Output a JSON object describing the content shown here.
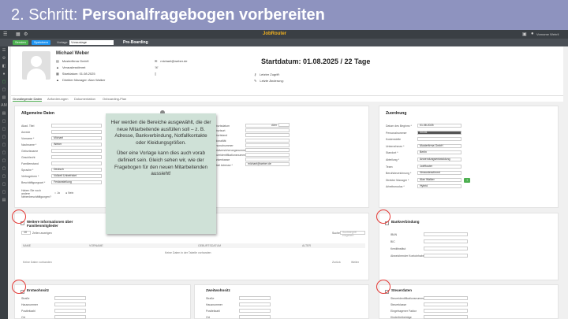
{
  "slide": {
    "title_prefix": "2. Schritt: ",
    "title_bold": "Personalfragebogen vorbereiten"
  },
  "app": {
    "brand": "JobRouter",
    "user": "Vorname Wehrli",
    "toolbar": {
      "send": "Senden",
      "save": "Speichern",
      "template_label": "Vorlage",
      "template_value": "Vorauslage",
      "process": "Pre-Boarding"
    },
    "sidebar_items": [
      "☰",
      "⚙",
      "◧",
      "●",
      "▢",
      "▢",
      "▤",
      "AM",
      "▤",
      "▢",
      "▢",
      "▢",
      "▢",
      "▢",
      "▢",
      "▢",
      "▢",
      "▢",
      "▢",
      "▤"
    ]
  },
  "profile": {
    "name": "Michael Weber",
    "company": "Musterfirma GmbH",
    "position": "Verauslesstimmt",
    "start": "Startdatum: 01.08.2025",
    "manager": "Direkter Manager: Alan Walker",
    "email": "michael@weber.de",
    "startdatum": "Startdatum: 01.08.2025 / 22 Tage",
    "access": "Letzter Zugriff:",
    "change": "Letzte Änderung:"
  },
  "tabs": [
    "Grundlegende Daten",
    "Anforderungen",
    "Dokumentation",
    "Onboarding-Plan"
  ],
  "allgemein": {
    "title": "Allgemeine Daten",
    "fields": [
      {
        "label": "Akad. Titel",
        "value": ""
      },
      {
        "label": "Anrede",
        "value": ""
      },
      {
        "label": "Vorname *",
        "value": "Michael"
      },
      {
        "label": "Nachname *",
        "value": "Weber"
      },
      {
        "label": "Geburtsname",
        "value": ""
      },
      {
        "label": "Geschlecht",
        "value": ""
      },
      {
        "label": "Familienstand",
        "value": ""
      },
      {
        "label": "Sprache *",
        "value": "Deutsch"
      },
      {
        "label": "Vertragsform *",
        "value": "Vollzeit Unbefristet"
      },
      {
        "label": "Beschäftigungsart *",
        "value": "Festanstellung"
      }
    ],
    "question": "Haben Sie noch andere Nebenbeschäftigungen?",
    "yes": "Ja",
    "no": "Nein",
    "right_labels": [
      "Geburtsdatum",
      "Geburtsort",
      "Geburtsland",
      "Nationalität",
      "Personalnummer",
      "Sozialversicherungsnummer",
      "Steueridentifikationsnummer",
      "Krankenkasse",
      "E-Mail Adresse *"
    ],
    "alter": "Alter",
    "email": "michael@weber.de"
  },
  "zuordnung": {
    "title": "Zuordnung",
    "fields": [
      {
        "label": "Datum des Beginns *",
        "value": "01.08.2025"
      },
      {
        "label": "Personalnummer",
        "value": "00181",
        "dark": true
      },
      {
        "label": "Kostenstelle",
        "value": ""
      },
      {
        "label": "Unternehmen *",
        "value": "Musterfirma GmbH"
      },
      {
        "label": "Standort *",
        "value": "Berlin"
      },
      {
        "label": "Abteilung *",
        "value": "Anwendungsentwicklung"
      },
      {
        "label": "Team",
        "value": "JobRouter"
      },
      {
        "label": "Berufsbezeichnung *",
        "value": "Verauslesstimmt"
      },
      {
        "label": "Direkter Manager *",
        "value": "Alan Walker"
      },
      {
        "label": "Arbeitsmodus *",
        "value": "Hybrid"
      }
    ]
  },
  "familie": {
    "title": "Weitere Informationen über Familienmitglieder",
    "entries_label": "Zeilen anzeigen",
    "entries_value": "10",
    "search_label": "Suche:",
    "search_placeholder": "Suchbegriff eingeben",
    "columns": [
      "NAME",
      "VORNAME",
      "GEBURTSDATUM",
      "ALTER"
    ],
    "empty": "Keine Daten in der Tabelle vorhanden",
    "info": "Keine Daten vorhanden",
    "prev": "Zurück",
    "next": "Weiter"
  },
  "bank": {
    "title": "Bankverbindung",
    "labels": [
      "IBAN",
      "BIC",
      "Kreditinstitut",
      "Abweichender Kontoinhaber"
    ]
  },
  "erstwohnsitz": {
    "title": "Erstwohnsitz",
    "labels": [
      "Straße",
      "Hausnummer",
      "Postleitzahl",
      "Ort"
    ]
  },
  "zweitwohnsitz": {
    "title": "Zweitwohnsitz",
    "labels": [
      "Straße",
      "Hausnummer",
      "Postleitzahl",
      "Ort"
    ]
  },
  "steuer": {
    "title": "Steuerdaten",
    "labels": [
      "Steueridentifikationsnummer",
      "Steuerklasse",
      "Eingetragener Faktor",
      "Kinderfreibeträge"
    ]
  },
  "callout": {
    "p1": "Hier werden die Bereiche ausgewählt, die der neue Mitarbeitende ausfüllen soll – z. B. Adresse, Bankverbindung, Notfallkontakte oder Kleidungsgrößen.",
    "p2": "Über eine Vorlage kann dies auch vorab definiert sein. Gleich sehen wir, wie der Fragebogen für den neuen Mitarbeitenden aussieht!"
  },
  "colors": {
    "header": "#8e93bf",
    "accent_green": "#4caf50",
    "accent_blue": "#2196f3",
    "highlight": "#e53935",
    "callout": "#cfe1d7"
  }
}
